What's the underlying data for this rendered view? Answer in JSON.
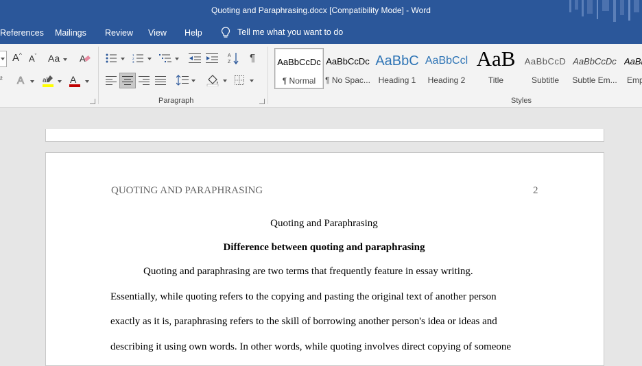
{
  "app": {
    "window_title": "Quoting and Paraphrasing.docx [Compatibility Mode]  -  Word"
  },
  "menu": {
    "tabs": [
      "References",
      "Mailings",
      "Review",
      "View",
      "Help"
    ],
    "tell_me": "Tell me what you want to do"
  },
  "ribbon": {
    "font_group": {
      "change_case_label": "Aa"
    },
    "paragraph_group_label": "Paragraph",
    "styles_group_label": "Styles",
    "styles": [
      {
        "preview": "AaBbCcDc",
        "label": "¶ Normal",
        "color": "#000000"
      },
      {
        "preview": "AaBbCcDc",
        "label": "¶ No Spac...",
        "color": "#000000"
      },
      {
        "preview": "AaBbC",
        "label": "Heading 1",
        "color": "#2e74b5"
      },
      {
        "preview": "AaBbCcl",
        "label": "Heading 2",
        "color": "#2e74b5"
      },
      {
        "preview": "AaB",
        "label": "Title",
        "color": "#000000"
      },
      {
        "preview": "AaBbCcD",
        "label": "Subtitle",
        "color": "#5a5a5a"
      },
      {
        "preview": "AaBbCcDc",
        "label": "Subtle Em...",
        "color": "#404040"
      },
      {
        "preview": "AaBl",
        "label": "Emp",
        "color": "#000000"
      }
    ],
    "selected_style": "¶ Normal"
  },
  "document": {
    "running_head": "QUOTING AND PARAPHRASING",
    "page_number": "2",
    "title": "Quoting and Paraphrasing",
    "heading": "Difference between quoting and paraphrasing",
    "lines": [
      "Quoting and paraphrasing are two terms that frequently feature in essay writing.",
      "Essentially, while quoting refers to the copying and pasting the original text of another person",
      "exactly as it is, paraphrasing refers to the skill of borrowing another person's idea or ideas and",
      "describing it using own words. In other words, while quoting involves direct copying of someone"
    ]
  },
  "colors": {
    "accent": "#2b579a",
    "highlight": "#ffff00",
    "font_color": "#c00000"
  }
}
